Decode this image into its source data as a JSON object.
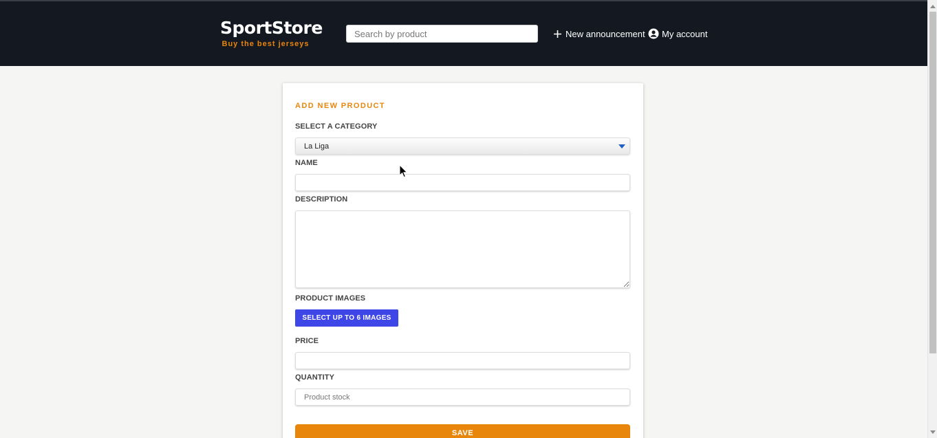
{
  "header": {
    "brand_title": "SportStore",
    "brand_subtitle": "Buy the best jerseys",
    "search_placeholder": "Search by product",
    "new_announcement_label": "New announcement",
    "new_announcement_icon": "plus-icon",
    "my_account_label": "My account",
    "my_account_icon": "user-circle-icon"
  },
  "form": {
    "title": "ADD NEW PRODUCT",
    "category_label": "SELECT A CATEGORY",
    "category_value": "La Liga",
    "name_label": "NAME",
    "name_value": "",
    "description_label": "DESCRIPTION",
    "description_value": "",
    "images_label": "PRODUCT IMAGES",
    "images_button": "SELECT UP TO 6 IMAGES",
    "price_label": "PRICE",
    "price_value": "",
    "quantity_label": "QUANTITY",
    "quantity_placeholder": "Product stock",
    "save_button": "SAVE"
  },
  "colors": {
    "header_bg": "#131821",
    "accent_orange": "#e8860c",
    "images_button_blue": "#3f46e8",
    "page_bg": "#f5f5f3"
  }
}
